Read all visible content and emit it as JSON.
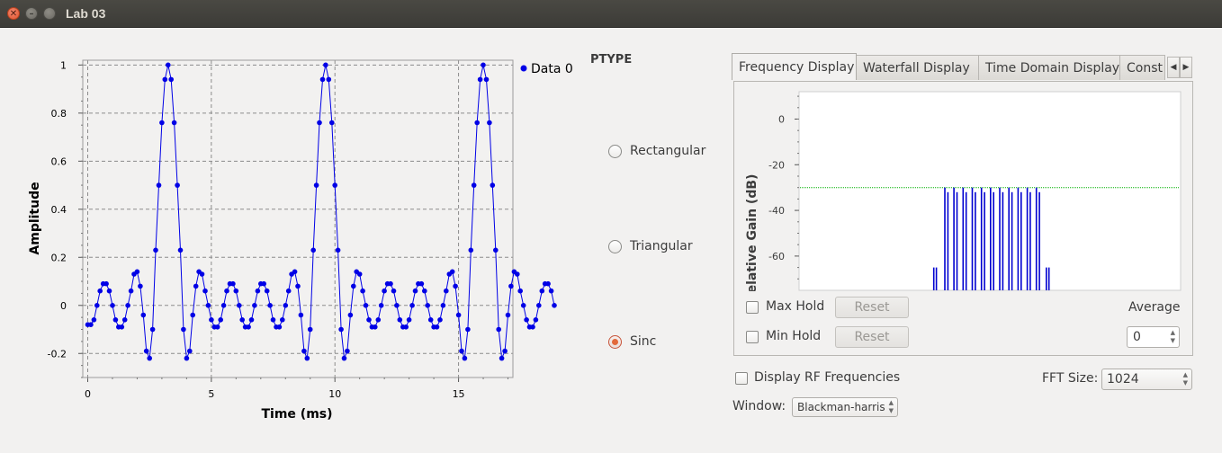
{
  "window": {
    "title": "Lab 03"
  },
  "time_plot": {
    "xlabel": "Time (ms)",
    "ylabel": "Amplitude",
    "legend": "Data 0",
    "color": "#0000e6",
    "x_ticks": [
      "0",
      "5",
      "10",
      "15"
    ],
    "y_ticks": [
      "1",
      "0.8",
      "0.6",
      "0.4",
      "0.2",
      "0",
      "-0.2"
    ]
  },
  "ptype": {
    "label": "PTYPE",
    "options": [
      {
        "label": "Rectangular",
        "checked": false
      },
      {
        "label": "Triangular",
        "checked": false
      },
      {
        "label": "Sinc",
        "checked": true
      }
    ]
  },
  "freq_panel": {
    "tabs": [
      "Frequency Display",
      "Waterfall Display",
      "Time Domain Display",
      "Const"
    ],
    "active_tab": "Frequency Display",
    "ylabel": "elative Gain (dB)",
    "y_ticks": [
      "0",
      "-20",
      "-40",
      "-60"
    ],
    "trace_color": "#0000d0",
    "maxhold_color": "#00b000",
    "max_hold_label": "Max Hold",
    "min_hold_label": "Min Hold",
    "reset_label": "Reset",
    "average_label": "Average",
    "average_value": "0",
    "display_rf_label": "Display RF Frequencies",
    "fft_size_label": "FFT Size:",
    "fft_size_value": "1024",
    "window_label": "Window:",
    "window_value": "Blackman-harris"
  },
  "chart_data": [
    {
      "type": "line",
      "title": "",
      "xlabel": "Time (ms)",
      "ylabel": "Amplitude",
      "xlim": [
        -0.2,
        17.2
      ],
      "ylim": [
        -0.3,
        1.02
      ],
      "grid": true,
      "legend": "top-right",
      "series": [
        {
          "name": "Data 0",
          "sample_interval_ms": 0.125,
          "x_start_ms": 0,
          "values": [
            -0.08,
            -0.08,
            -0.06,
            0.0,
            0.06,
            0.09,
            0.09,
            0.06,
            0.0,
            -0.06,
            -0.09,
            -0.09,
            -0.06,
            0.0,
            0.06,
            0.13,
            0.14,
            0.08,
            -0.04,
            -0.19,
            -0.22,
            -0.1,
            0.23,
            0.5,
            0.76,
            0.94,
            1.0,
            0.94,
            0.76,
            0.5,
            0.23,
            -0.1,
            -0.22,
            -0.19,
            -0.04,
            0.08,
            0.14,
            0.13,
            0.06,
            0.0,
            -0.06,
            -0.09,
            -0.09,
            -0.06,
            0.0,
            0.06,
            0.09,
            0.09,
            0.06,
            0.0,
            -0.06,
            -0.09,
            -0.09,
            -0.06,
            0.0,
            0.06,
            0.09,
            0.09,
            0.06,
            0.0,
            -0.06,
            -0.09,
            -0.09,
            -0.06,
            0.0,
            0.06,
            0.13,
            0.14,
            0.08,
            -0.04,
            -0.19,
            -0.22,
            -0.1,
            0.23,
            0.5,
            0.76,
            0.94,
            1.0,
            0.94,
            0.76,
            0.5,
            0.23,
            -0.1,
            -0.22,
            -0.19,
            -0.04,
            0.08,
            0.14,
            0.13,
            0.06,
            0.0,
            -0.06,
            -0.09,
            -0.09,
            -0.06,
            0.0,
            0.06,
            0.09,
            0.09,
            0.06,
            0.0,
            -0.06,
            -0.09,
            -0.09,
            -0.06,
            0.0,
            0.06,
            0.09,
            0.09,
            0.06,
            0.0,
            -0.06,
            -0.09,
            -0.09,
            -0.06,
            0.0,
            0.06,
            0.13,
            0.14,
            0.08,
            -0.04,
            -0.19,
            -0.22,
            -0.1,
            0.23,
            0.5,
            0.76,
            0.94,
            1.0,
            0.94,
            0.76,
            0.5,
            0.23,
            -0.1,
            -0.22,
            -0.19,
            -0.04,
            0.08,
            0.14,
            0.13,
            0.06,
            0.0,
            -0.06,
            -0.09,
            -0.09,
            -0.06,
            0.0,
            0.06,
            0.09,
            0.09,
            0.06,
            0.0
          ]
        }
      ]
    },
    {
      "type": "line",
      "title": "",
      "ylabel": "elative Gain (dB)",
      "ylim": [
        -75,
        12
      ],
      "grid": false,
      "max_hold_level_db": -30,
      "spectrum_lines": [
        {
          "pos": 0.353,
          "top_db": -65
        },
        {
          "pos": 0.36,
          "top_db": -65
        },
        {
          "pos": 0.382,
          "top_db": -30
        },
        {
          "pos": 0.39,
          "top_db": -32
        },
        {
          "pos": 0.406,
          "top_db": -30
        },
        {
          "pos": 0.414,
          "top_db": -32
        },
        {
          "pos": 0.43,
          "top_db": -30
        },
        {
          "pos": 0.438,
          "top_db": -32
        },
        {
          "pos": 0.454,
          "top_db": -30
        },
        {
          "pos": 0.462,
          "top_db": -32
        },
        {
          "pos": 0.478,
          "top_db": -30
        },
        {
          "pos": 0.486,
          "top_db": -32
        },
        {
          "pos": 0.502,
          "top_db": -30
        },
        {
          "pos": 0.51,
          "top_db": -32
        },
        {
          "pos": 0.526,
          "top_db": -30
        },
        {
          "pos": 0.534,
          "top_db": -32
        },
        {
          "pos": 0.55,
          "top_db": -30
        },
        {
          "pos": 0.558,
          "top_db": -32
        },
        {
          "pos": 0.574,
          "top_db": -30
        },
        {
          "pos": 0.582,
          "top_db": -32
        },
        {
          "pos": 0.598,
          "top_db": -30
        },
        {
          "pos": 0.606,
          "top_db": -32
        },
        {
          "pos": 0.622,
          "top_db": -30
        },
        {
          "pos": 0.63,
          "top_db": -32
        },
        {
          "pos": 0.648,
          "top_db": -65
        },
        {
          "pos": 0.655,
          "top_db": -65
        }
      ]
    }
  ]
}
